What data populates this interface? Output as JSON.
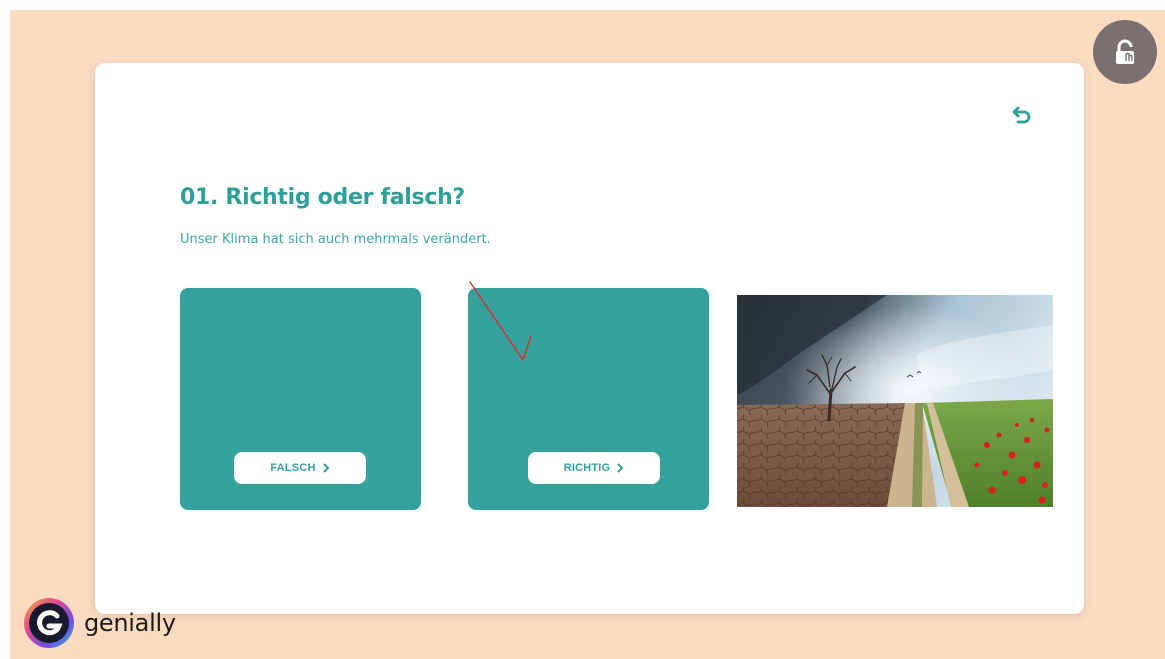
{
  "quiz": {
    "title": "01. Richtig oder falsch?",
    "statement": "Unser Klima hat sich auch mehrmals verändert."
  },
  "answers": [
    {
      "label": "FALSCH",
      "icon": "chevron-right-icon"
    },
    {
      "label": "RICHTIG",
      "icon": "chevron-right-icon"
    }
  ],
  "image": {
    "alt": ""
  },
  "toolbar": {
    "undo_icon": "undo-icon",
    "lock_icon": "unlock-icon"
  },
  "brand": {
    "name": "genially"
  },
  "colors": {
    "background": "#fcdcc1",
    "teal": "#34a19c",
    "title": "#2e9f99",
    "lock_button": "#7a7070",
    "annotation": "#e8252b"
  }
}
